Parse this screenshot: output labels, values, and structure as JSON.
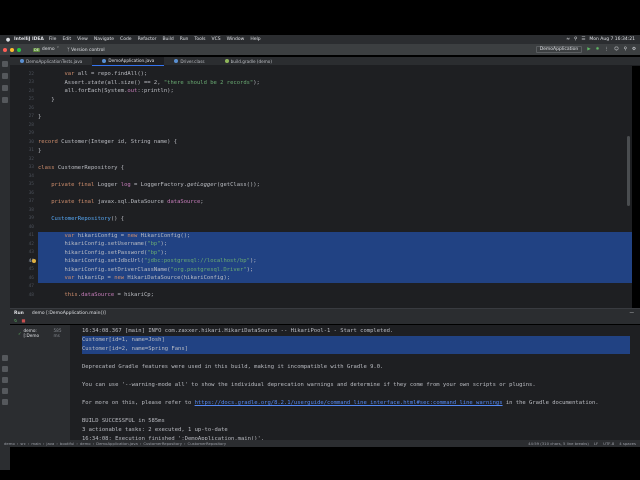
{
  "menubar": {
    "app_name": "IntelliJ IDEA",
    "items": [
      "File",
      "Edit",
      "View",
      "Navigate",
      "Code",
      "Refactor",
      "Build",
      "Run",
      "Tools",
      "VCS",
      "Window",
      "Help"
    ],
    "clock": "Mon Aug 7  16:34:21"
  },
  "toolbar": {
    "project_badge": "DE",
    "project_name": "demo",
    "version_control": "Version control",
    "run_config": "DemoApplication"
  },
  "tabs": [
    {
      "label": "DemoApplicationTests.java",
      "active": false
    },
    {
      "label": "DemoApplication.java",
      "active": true
    },
    {
      "label": "Driver.class",
      "active": false
    },
    {
      "label": "build.gradle (demo)",
      "active": false
    }
  ],
  "editor": {
    "lines": [
      {
        "n": "22",
        "code": [
          [
            "",
            "        "
          ],
          [
            "kw",
            "var"
          ],
          [
            "",
            " all = repo.findAll();"
          ]
        ]
      },
      {
        "n": "23",
        "code": [
          [
            "",
            "        Assert."
          ],
          [
            "ital",
            "state"
          ],
          [
            "",
            "(all.size() == 2, "
          ],
          [
            "str",
            "\"there should be 2 records\""
          ],
          [
            "",
            ");"
          ]
        ]
      },
      {
        "n": "24",
        "code": [
          [
            "",
            "        all.forEach(System."
          ],
          [
            "fld",
            "out"
          ],
          [
            "",
            "::println);"
          ]
        ]
      },
      {
        "n": "25",
        "code": [
          [
            "",
            "    }"
          ]
        ]
      },
      {
        "n": "26",
        "code": [
          [
            "",
            ""
          ]
        ]
      },
      {
        "n": "27",
        "code": [
          [
            "",
            "}"
          ]
        ]
      },
      {
        "n": "28",
        "code": [
          [
            "",
            ""
          ]
        ]
      },
      {
        "n": "29",
        "code": [
          [
            "",
            ""
          ]
        ]
      },
      {
        "n": "30",
        "code": [
          [
            "kw",
            "record"
          ],
          [
            "",
            " Customer(Integer id, String name) {"
          ]
        ]
      },
      {
        "n": "31",
        "code": [
          [
            "",
            "}"
          ]
        ]
      },
      {
        "n": "32",
        "code": [
          [
            "",
            ""
          ]
        ]
      },
      {
        "n": "33",
        "code": [
          [
            "kw",
            "class"
          ],
          [
            "",
            " CustomerRepository {"
          ]
        ]
      },
      {
        "n": "34",
        "code": [
          [
            "",
            ""
          ]
        ]
      },
      {
        "n": "35",
        "code": [
          [
            "",
            "    "
          ],
          [
            "kw",
            "private final"
          ],
          [
            "",
            " Logger "
          ],
          [
            "fld",
            "log"
          ],
          [
            "",
            " = LoggerFactory."
          ],
          [
            "ital",
            "getLogger"
          ],
          [
            "",
            "(getClass());"
          ]
        ]
      },
      {
        "n": "36",
        "code": [
          [
            "",
            ""
          ]
        ]
      },
      {
        "n": "37",
        "code": [
          [
            "",
            "    "
          ],
          [
            "kw",
            "private final"
          ],
          [
            "",
            " javax.sql.DataSource "
          ],
          [
            "fld",
            "dataSource"
          ],
          [
            "",
            ";"
          ]
        ]
      },
      {
        "n": "38",
        "code": [
          [
            "",
            ""
          ]
        ]
      },
      {
        "n": "39",
        "code": [
          [
            "",
            "    "
          ],
          [
            "mth",
            "CustomerRepository"
          ],
          [
            "",
            "() {"
          ]
        ]
      },
      {
        "n": "40",
        "code": [
          [
            "",
            ""
          ]
        ]
      },
      {
        "n": "41",
        "code": [
          [
            "",
            "        "
          ],
          [
            "kw",
            "var"
          ],
          [
            "",
            " hikariConfig = "
          ],
          [
            "kw",
            "new"
          ],
          [
            "",
            " HikariConfig();"
          ]
        ]
      },
      {
        "n": "42",
        "code": [
          [
            "",
            "        hikariConfig.setUsername("
          ],
          [
            "str",
            "\"bp\""
          ],
          [
            "",
            ");"
          ]
        ]
      },
      {
        "n": "43",
        "code": [
          [
            "",
            "        hikariConfig.setPassword("
          ],
          [
            "str",
            "\"bp\""
          ],
          [
            "",
            ");"
          ]
        ]
      },
      {
        "n": "44",
        "code": [
          [
            "",
            "        hikariConfig.setJdbcUrl("
          ],
          [
            "str",
            "\"jdbc:postgresql://localhost/bp\""
          ],
          [
            "",
            ");"
          ]
        ]
      },
      {
        "n": "45",
        "code": [
          [
            "",
            "        hikariConfig.setDriverClassName("
          ],
          [
            "str",
            "\"org.postgresql.Driver\""
          ],
          [
            "",
            ");"
          ]
        ]
      },
      {
        "n": "46",
        "code": [
          [
            "",
            "        "
          ],
          [
            "kw",
            "var"
          ],
          [
            "",
            " hikariCp = "
          ],
          [
            "kw",
            "new"
          ],
          [
            "",
            " HikariDataSource(hikariConfig);"
          ]
        ]
      },
      {
        "n": "47",
        "code": [
          [
            "",
            ""
          ]
        ]
      },
      {
        "n": "48",
        "code": [
          [
            "",
            "        "
          ],
          [
            "kw",
            "this"
          ],
          [
            "",
            "."
          ],
          [
            "fld",
            "dataSource"
          ],
          [
            "",
            " = hikariCp;"
          ]
        ]
      }
    ],
    "current_line_number": "44"
  },
  "run": {
    "title": "Run",
    "tab_label": "demo [:DemoApplication.main()]",
    "tree_node": "demo: [:Demo",
    "tree_time": "585 ms",
    "console": [
      "16:34:08.367 [main] INFO com.zaxxer.hikari.HikariDataSource -- HikariPool-1 - Start completed.",
      "Customer[id=1, name=Josh]",
      "Customer[id=2, name=Spring Fans]",
      "",
      "Deprecated Gradle features were used in this build, making it incompatible with Gradle 9.0.",
      "",
      "You can use '--warning-mode all' to show the individual deprecation warnings and determine if they come from your own scripts or plugins.",
      "",
      "For more on this, please refer to ",
      "",
      "BUILD SUCCESSFUL in 585ms",
      "3 actionable tasks: 2 executed, 1 up-to-date",
      "16:34:08: Execution finished ':DemoApplication.main()'."
    ],
    "link_text": "https://docs.gradle.org/8.2.1/userguide/command_line_interface.html#sec:command_line_warnings",
    "link_suffix": " in the Gradle documentation."
  },
  "statusbar": {
    "breadcrumbs": [
      "demo",
      "src",
      "main",
      "java",
      "bootiful",
      "demo",
      "DemoApplication.java",
      "CustomerRepository",
      "CustomerRepository"
    ],
    "position": "44:59 (310 chars, 5 line breaks)",
    "line_sep": "LF",
    "encoding": "UTF-8",
    "indent": "4 spaces"
  },
  "colors": {
    "selection": "#214283",
    "keyword": "#cf8e6d",
    "string": "#6aab73",
    "field": "#c77dbb",
    "link": "#548af7"
  }
}
